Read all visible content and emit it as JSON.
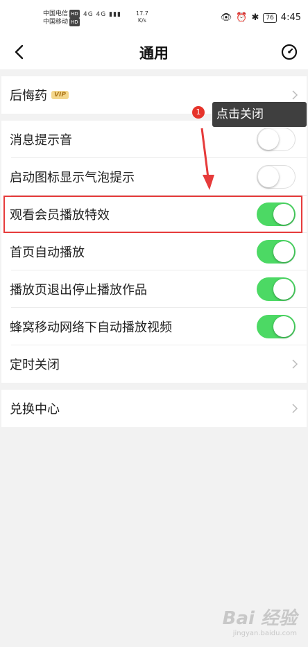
{
  "status_bar": {
    "carrier1": "中国电信",
    "carrier2": "中国移动",
    "hd": "HD",
    "signal": "4G 4G",
    "speed_value": "17.7",
    "speed_unit": "K/s",
    "battery": "76",
    "time": "4:45"
  },
  "header": {
    "title": "通用"
  },
  "rows": [
    {
      "label": "后悔药",
      "badge": "VIP",
      "control": "chevron"
    },
    {
      "label": "消息提示音",
      "control": "toggle",
      "on": false
    },
    {
      "label": "启动图标显示气泡提示",
      "control": "toggle",
      "on": false
    },
    {
      "label": "观看会员播放特效",
      "control": "toggle",
      "on": true
    },
    {
      "label": "首页自动播放",
      "control": "toggle",
      "on": true
    },
    {
      "label": "播放页退出停止播放作品",
      "control": "toggle",
      "on": true
    },
    {
      "label": "蜂窝移动网络下自动播放视频",
      "control": "toggle",
      "on": true
    },
    {
      "label": "定时关闭",
      "control": "chevron"
    },
    {
      "label": "兑换中心",
      "control": "chevron"
    }
  ],
  "annotation": {
    "number": "1",
    "text": "点击关闭",
    "color": "#e63b3b"
  },
  "watermark": {
    "brand": "Bai 经验",
    "url": "jingyan.baidu.com"
  },
  "colors": {
    "toggle_on": "#4cd964",
    "background": "#f2f2f2"
  }
}
